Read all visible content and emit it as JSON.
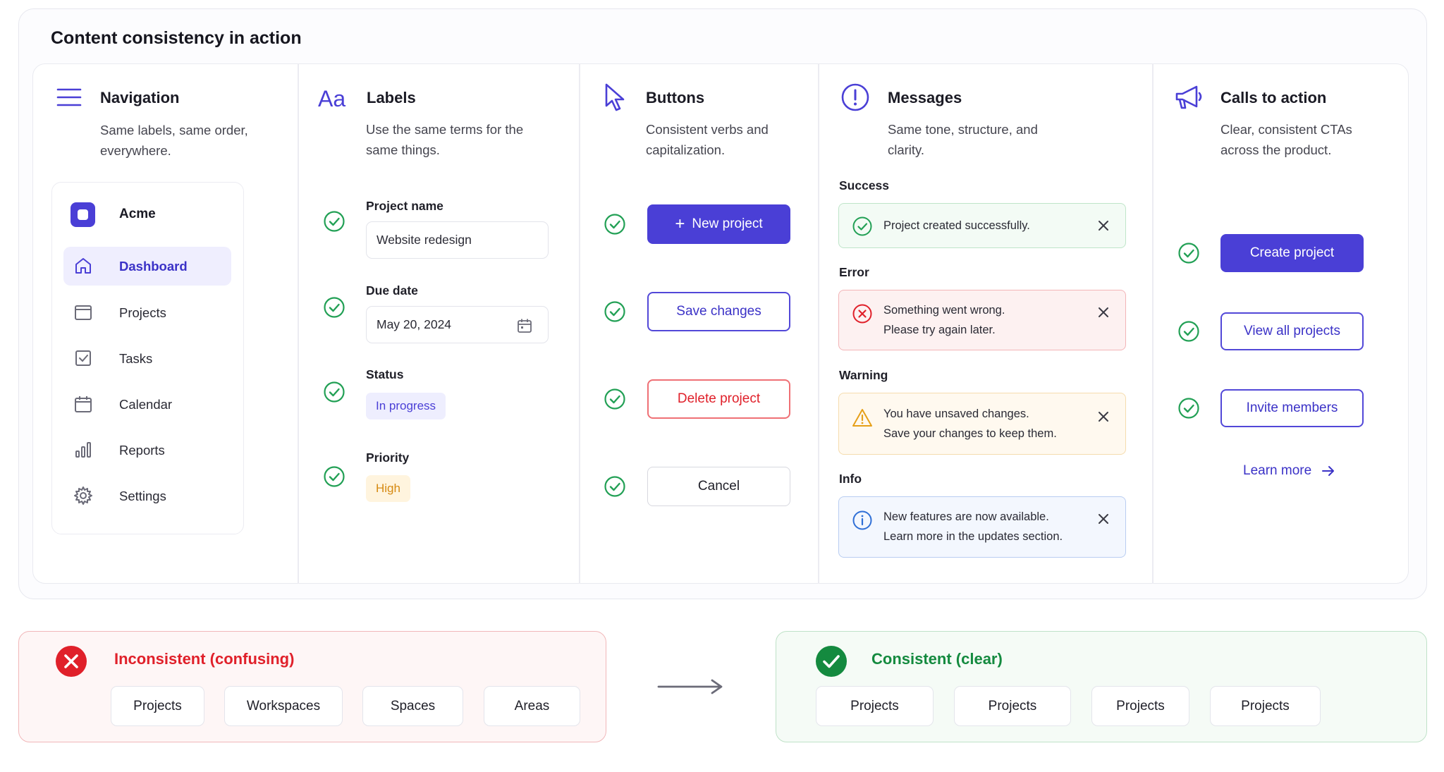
{
  "page_title": "Content consistency in action",
  "colors": {
    "accent": "#4a3fd6",
    "success": "#16a34a",
    "error": "#e0202a",
    "warning": "#e6a019",
    "info": "#2f6fd6"
  },
  "navigation": {
    "title": "Navigation",
    "subtitle": "Same labels, same order, everywhere.",
    "brand": "Acme",
    "items": [
      {
        "label": "Dashboard",
        "icon": "home-icon",
        "active": true
      },
      {
        "label": "Projects",
        "icon": "folder-icon"
      },
      {
        "label": "Tasks",
        "icon": "checkbox-icon"
      },
      {
        "label": "Calendar",
        "icon": "calendar-icon"
      },
      {
        "label": "Reports",
        "icon": "bar-chart-icon"
      },
      {
        "label": "Settings",
        "icon": "gear-icon"
      }
    ]
  },
  "labels": {
    "title": "Labels",
    "subtitle": "Use the same terms for the same things.",
    "project_name_label": "Project name",
    "project_name_value": "Website redesign",
    "due_date_label": "Due date",
    "due_date_value": "May 20, 2024",
    "status_label": "Status",
    "status_value": "In progress",
    "priority_label": "Priority",
    "priority_value": "High"
  },
  "buttons": {
    "title": "Buttons",
    "subtitle": "Consistent verbs and capitalization.",
    "new_project": "New project",
    "save_changes": "Save changes",
    "delete_project": "Delete project",
    "cancel": "Cancel"
  },
  "messages": {
    "title": "Messages",
    "subtitle": "Same tone, structure, and clarity.",
    "success_label": "Success",
    "success_text": "Project created successfully.",
    "error_label": "Error",
    "error_line1": "Something went wrong.",
    "error_line2": "Please try again later.",
    "warning_label": "Warning",
    "warning_line1": "You have unsaved changes.",
    "warning_line2": "Save your changes to keep them.",
    "info_label": "Info",
    "info_line1": "New features are now available.",
    "info_line2": "Learn more in the updates section."
  },
  "cta": {
    "title": "Calls to action",
    "subtitle": "Clear, consistent CTAs across the product.",
    "create_project": "Create project",
    "view_all_projects": "View all projects",
    "invite_members": "Invite members",
    "learn_more": "Learn more"
  },
  "inconsistent": {
    "title": "Inconsistent (confusing)",
    "chips": [
      "Projects",
      "Workspaces",
      "Spaces",
      "Areas"
    ]
  },
  "consistent": {
    "title": "Consistent (clear)",
    "chips": [
      "Projects",
      "Projects",
      "Projects",
      "Projects"
    ]
  }
}
